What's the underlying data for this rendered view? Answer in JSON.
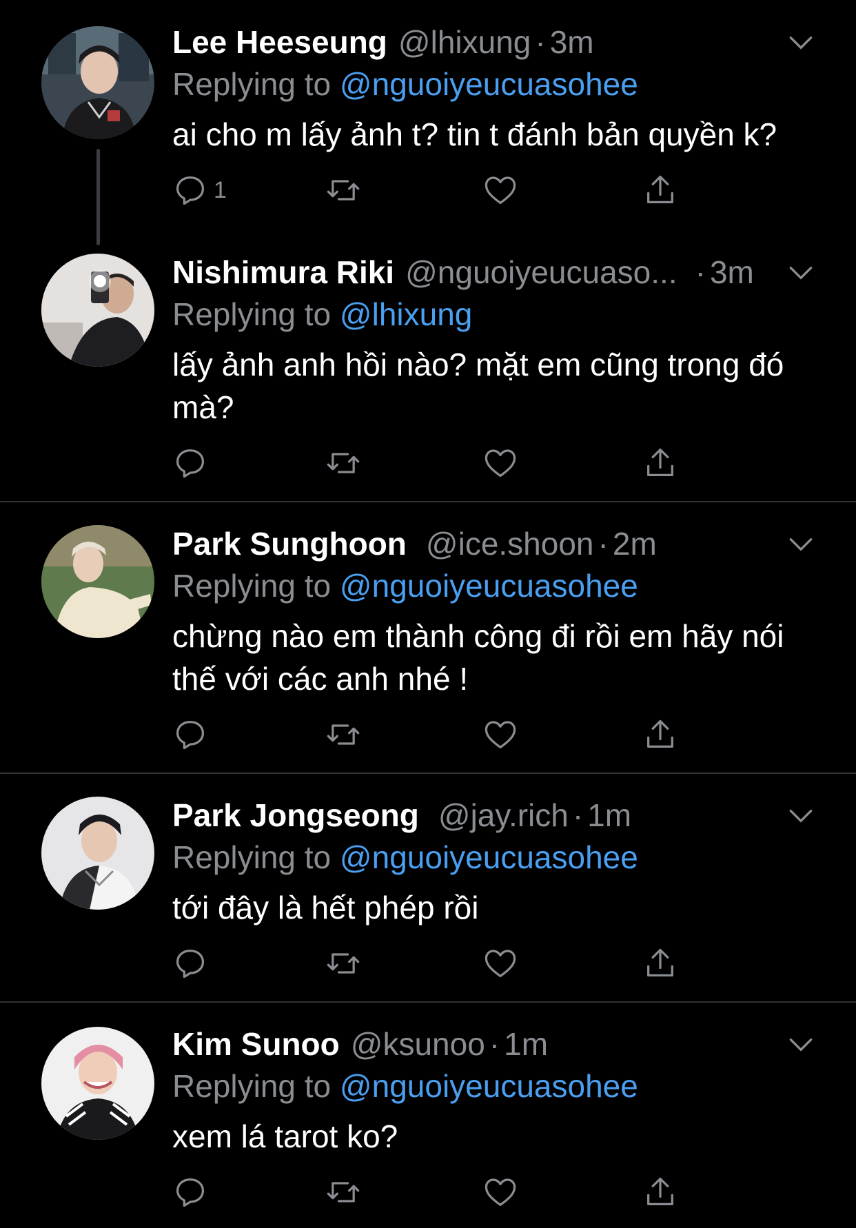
{
  "tweets": [
    {
      "name": "Lee Heeseung",
      "handle": "@lhixung",
      "time": "3m",
      "replying_label": "Replying to",
      "replying_to": "@nguoiyeucuasohee",
      "text": "ai cho m lấy ảnh t? tin t đánh bản quyền k?",
      "reply_count": "1"
    },
    {
      "name": "Nishimura Riki",
      "handle": "@nguoiyeucuaso...",
      "time": "3m",
      "replying_label": "Replying to",
      "replying_to": "@lhixung",
      "text": "lấy ảnh anh hồi nào? mặt em cũng trong đó mà?",
      "reply_count": ""
    },
    {
      "name": "Park Sunghoon",
      "handle": "@ice.shoon",
      "time": "2m",
      "replying_label": "Replying to",
      "replying_to": "@nguoiyeucuasohee",
      "text": "chừng nào em thành công đi rồi em hãy nói thế với các anh nhé !",
      "reply_count": ""
    },
    {
      "name": "Park Jongseong",
      "handle": "@jay.rich",
      "time": "1m",
      "replying_label": "Replying to",
      "replying_to": "@nguoiyeucuasohee",
      "text": "tới đây là hết phép rồi",
      "reply_count": ""
    },
    {
      "name": "Kim Sunoo",
      "handle": "@ksunoo",
      "time": "1m",
      "replying_label": "Replying to",
      "replying_to": "@nguoiyeucuasohee",
      "text": "xem lá tarot ko?",
      "reply_count": ""
    }
  ],
  "dot_separator": "·",
  "icons": {
    "reply": "reply-icon",
    "retweet": "retweet-icon",
    "like": "heart-icon",
    "share": "share-icon",
    "more": "chevron-down-icon"
  },
  "colors": {
    "background": "#000000",
    "text": "#ffffff",
    "secondary": "#8a8d91",
    "link": "#4a9ff0",
    "divider": "#2f3336"
  }
}
